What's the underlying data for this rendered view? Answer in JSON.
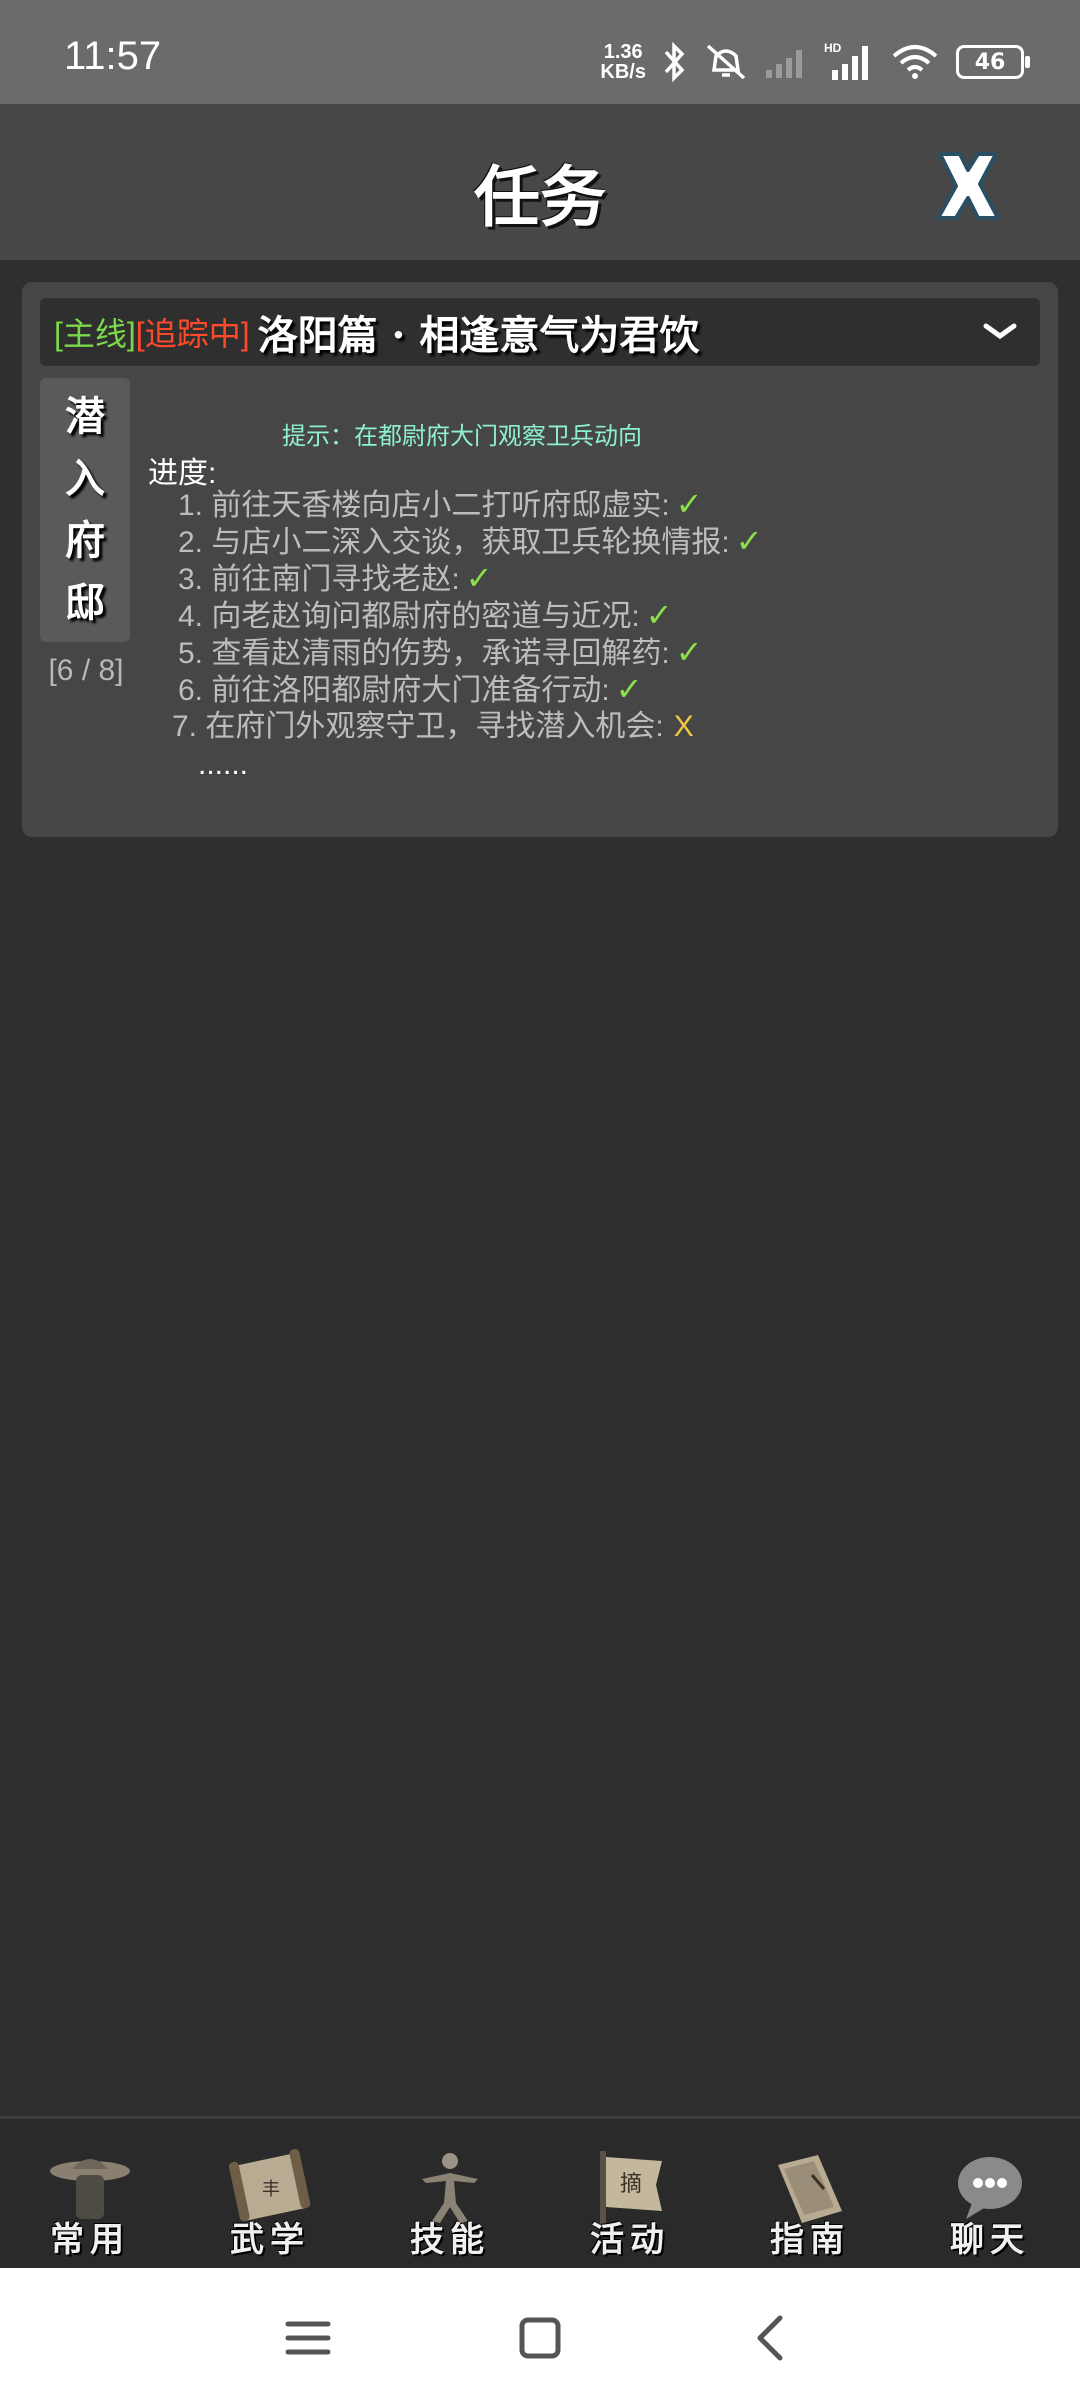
{
  "status_bar": {
    "time": "11:57",
    "net_speed_value": "1.36",
    "net_speed_unit": "KB/s",
    "battery": "46"
  },
  "header": {
    "title": "任务"
  },
  "quest": {
    "tag_main": "[主线]",
    "tag_tracking": "[追踪中]",
    "title": "洛阳篇 · 相逢意气为君饮",
    "stage_name": [
      "潜",
      "入",
      "府",
      "邸"
    ],
    "stage_count": "[6 / 8]",
    "hint": "提示：在都尉府大门观察卫兵动向",
    "progress_label": "进度:",
    "steps": [
      {
        "text": "1. 前往天香楼向店小二打听府邸虚实:",
        "status": "✓"
      },
      {
        "text": "2. 与店小二深入交谈，获取卫兵轮换情报:",
        "status": "✓"
      },
      {
        "text": "3. 前往南门寻找老赵:",
        "status": "✓"
      },
      {
        "text": "4. 向老赵询问都尉府的密道与近况:",
        "status": "✓"
      },
      {
        "text": "5. 查看赵清雨的伤势，承诺寻回解药:",
        "status": "✓"
      },
      {
        "text": "6. 前往洛阳都尉府大门准备行动:",
        "status": "✓"
      },
      {
        "text": "7. 在府门外观察守卫，寻找潜入机会:",
        "status": "X"
      }
    ],
    "ellipsis": "......"
  },
  "bottom_nav": [
    {
      "label": "常用",
      "icon": "straw-hat-figure-icon"
    },
    {
      "label": "武学",
      "icon": "scroll-icon"
    },
    {
      "label": "技能",
      "icon": "martial-pose-icon"
    },
    {
      "label": "活动",
      "icon": "banner-icon"
    },
    {
      "label": "指南",
      "icon": "book-icon"
    },
    {
      "label": "聊天",
      "icon": "chat-bubble-icon"
    }
  ],
  "colors": {
    "main_tag": "#7bd84a",
    "tracking_tag": "#ff4a2a",
    "check": "#8be04a",
    "pending": "#f2c744",
    "hint": "#8ff0d0"
  }
}
